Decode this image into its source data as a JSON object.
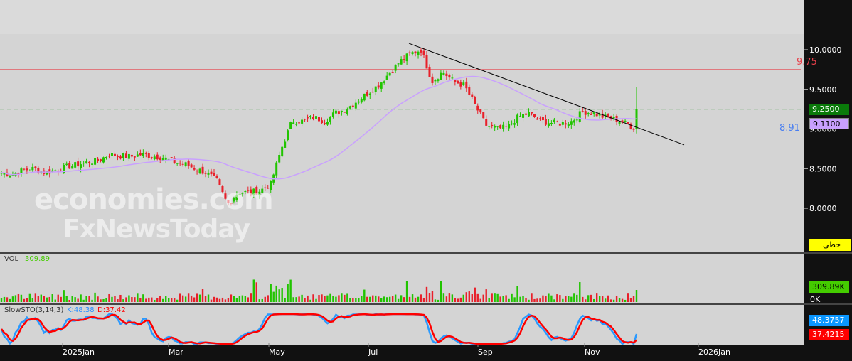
{
  "chart_data": {
    "type": "candlestick",
    "y_axis": {
      "ticks": [
        "10.0000",
        "9.5000",
        "9.0000",
        "8.5000",
        "8.0000"
      ],
      "tick_values": [
        10,
        9.5,
        9,
        8.5,
        8
      ],
      "ylim": [
        7.55,
        10.3
      ]
    },
    "x_axis": {
      "ticks": [
        "2025Jan",
        "Mar",
        "May",
        "Jul",
        "Sep",
        "Nov",
        "2026Jan"
      ]
    },
    "close_path": [
      8.45,
      8.42,
      8.48,
      8.5,
      8.45,
      8.48,
      8.52,
      8.55,
      8.58,
      8.6,
      8.68,
      8.66,
      8.65,
      8.68,
      8.66,
      8.64,
      8.58,
      8.56,
      8.5,
      8.45,
      8.35,
      8.05,
      8.2,
      8.2,
      8.22,
      8.3,
      8.75,
      9.1,
      9.1,
      9.15,
      9.1,
      9.2,
      9.25,
      9.35,
      9.45,
      9.55,
      9.7,
      9.85,
      9.95,
      10.0,
      9.6,
      9.72,
      9.6,
      9.55,
      9.3,
      9.05,
      9.0,
      9.02,
      9.15,
      9.2,
      9.1,
      9.08,
      9.07,
      9.1,
      9.22,
      9.2,
      9.15,
      9.12,
      9.07,
      9.0,
      9.25
    ],
    "horizontal_lines": [
      {
        "value": 9.75,
        "label": "9.75",
        "color": "#e8404a"
      },
      {
        "value": 8.91,
        "label": "8.91",
        "color": "#4a7ff0"
      },
      {
        "value": 9.25,
        "color": "#138a13",
        "style": "dashed"
      }
    ],
    "trendline": {
      "from": [
        10.08
      ],
      "to": [
        8.8
      ]
    },
    "moving_average": {
      "color": "#c9a0ff"
    },
    "last_price": "9.2500",
    "ma_value": "9.1100",
    "chart_type_label": "خطي",
    "volume": {
      "label": "VOL",
      "value": "309.89",
      "axis_zero": "0K",
      "last_badge": "309.89K"
    },
    "stochastic": {
      "label": "SlowSTO(3,14,3)",
      "k_label": "K:48.38",
      "d_label": "D:37.42",
      "k_badge": "48.3757",
      "d_badge": "37.4215"
    }
  },
  "watermark": {
    "line1": "economies.com",
    "line2": "FxNewsToday"
  },
  "colors": {
    "up": "#21c400",
    "down": "#e8202a",
    "bg": "#d4d4d4",
    "axis": "#111111"
  }
}
